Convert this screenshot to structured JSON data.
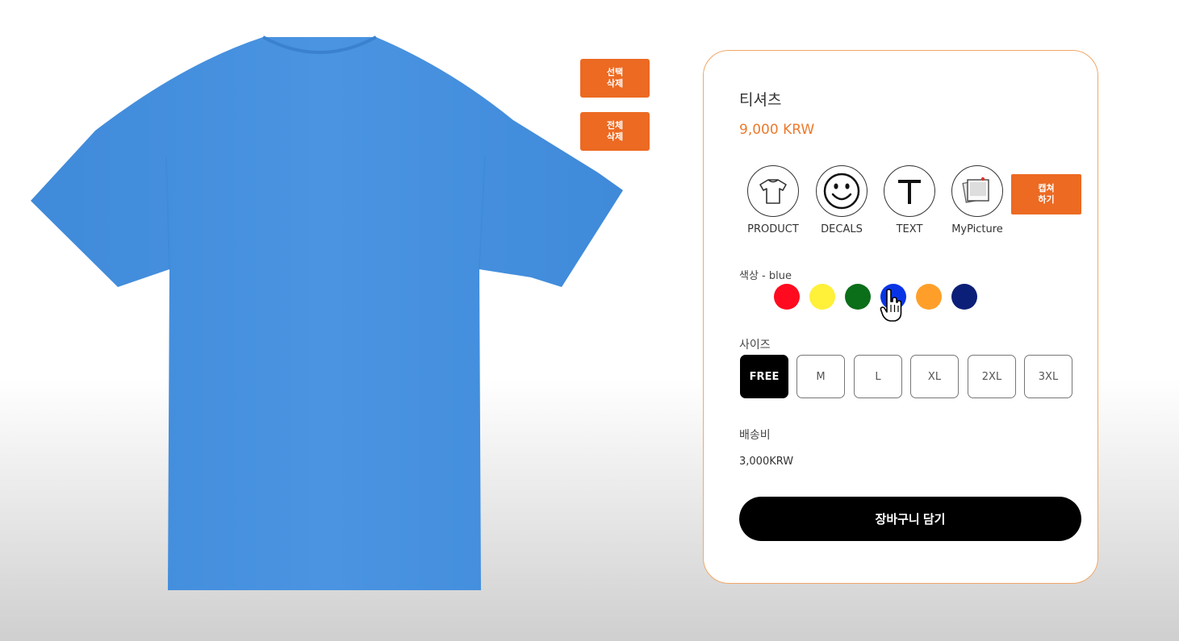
{
  "canvas": {
    "delete_selected_label": "선택\n삭제",
    "delete_all_label": "전체\n삭제",
    "product_color": "#4a93e0"
  },
  "product": {
    "name": "티셔츠",
    "price": "9,000 KRW"
  },
  "tools": [
    {
      "label": "PRODUCT",
      "icon": "tshirt-icon"
    },
    {
      "label": "DECALS",
      "icon": "smiley-icon"
    },
    {
      "label": "TEXT",
      "icon": "text-t-icon"
    },
    {
      "label": "MyPicture",
      "icon": "photos-icon"
    }
  ],
  "capture_label": "캡쳐\n하기",
  "color": {
    "label": "색상 - blue",
    "swatches": [
      {
        "name": "red",
        "hex": "#ff0a1e"
      },
      {
        "name": "yellow",
        "hex": "#fff03a"
      },
      {
        "name": "green",
        "hex": "#0b6e19"
      },
      {
        "name": "blue",
        "hex": "#0834e6",
        "selected": true
      },
      {
        "name": "orange",
        "hex": "#ff9f2a"
      },
      {
        "name": "navy",
        "hex": "#0c1f78"
      }
    ]
  },
  "size": {
    "label": "사이즈",
    "options": [
      "FREE",
      "M",
      "L",
      "XL",
      "2XL",
      "3XL"
    ],
    "selected": "FREE"
  },
  "shipping": {
    "label": "배송비",
    "value": "3,000KRW"
  },
  "cart_button": "장바구니 담기",
  "accent_color": "#ec6a22"
}
